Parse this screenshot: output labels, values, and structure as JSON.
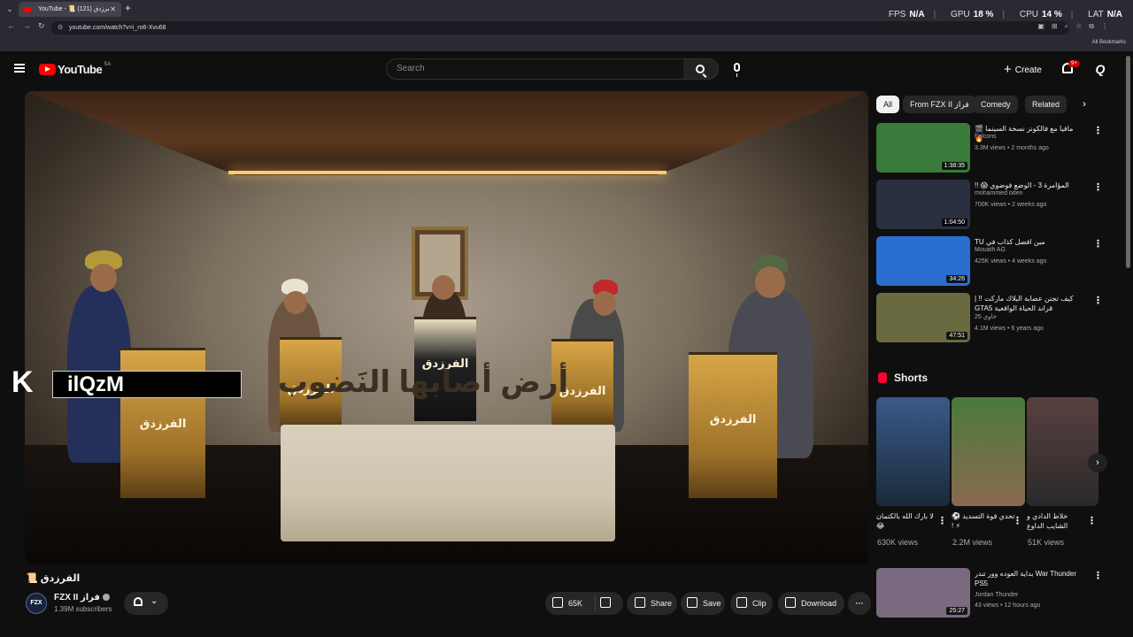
{
  "browser": {
    "tab_title": "YouTube - 📜 الفرزدق (121)",
    "url": "youtube.com/watch?v=i_ro6-Xvu68",
    "all_bookmarks": "All Bookmarks"
  },
  "overlay": {
    "fps_label": "FPS",
    "fps_value": "N/A",
    "gpu_label": "GPU",
    "gpu_value": "18 %",
    "cpu_label": "CPU",
    "cpu_value": "14 %",
    "lat_label": "LAT",
    "lat_value": "N/A"
  },
  "header": {
    "logo": "YouTube",
    "country": "SA",
    "search_placeholder": "Search",
    "create": "Create",
    "notif_count": "9+"
  },
  "video": {
    "scroll_text": "أرض أصابها النَضوب",
    "watermark_text": "ilQzM",
    "title": "الفرزدق 📜",
    "channel_name": "FZX II فراز",
    "subscribers": "1.39M subscribers",
    "likes": "65K",
    "share": "Share",
    "save": "Save",
    "clip": "Clip",
    "download": "Download"
  },
  "chips": [
    "All",
    "From FZX II فراز",
    "Comedy",
    "Related"
  ],
  "recommendations": [
    {
      "title": "مافيا مع فالكونز نسخة السينما 🎬 🔥",
      "channel": "Falcons",
      "meta": "3.3M views • 2 months ago",
      "duration": "1:38:35",
      "color": "#3a7a3a"
    },
    {
      "title": "المؤامرة 3 - الوضع فوضوي 😱 !!",
      "channel": "mohammed oden",
      "meta": "700K views • 2 weeks ago",
      "duration": "1:04:50",
      "color": "#2a3040"
    },
    {
      "title": "مين افضل كذاب في TU",
      "channel": "Mouath AG",
      "meta": "425K views • 4 weeks ago",
      "duration": "34:26",
      "color": "#2a6fd0"
    },
    {
      "title": "كيف تجنن عصابة البلاك ماركت !! | قراند الحياة الواقعية GTA5",
      "channel": "25 خاوي",
      "meta": "4.1M views • 6 years ago",
      "duration": "47:51",
      "color": "#6a6a40"
    },
    {
      "title": "بداية العوده وور تندر War Thunder PS5",
      "channel": "Jordan Thunder",
      "meta": "43 views • 12 hours ago",
      "duration": "25:27",
      "color": "#7a6a80"
    }
  ],
  "shorts": {
    "heading": "Shorts",
    "items": [
      {
        "title": "لا بارك الله بالكتمان 😂",
        "views": "630K views",
        "color": "#3a5a8a"
      },
      {
        "title": "تحدي قوة التسديد ⚽ ⚡ !",
        "views": "2.2M views",
        "color": "#4a7a3a"
      },
      {
        "title": "خلاط الدادي و الشايب الداوع",
        "views": "51K views",
        "color": "#5a4040"
      }
    ]
  }
}
